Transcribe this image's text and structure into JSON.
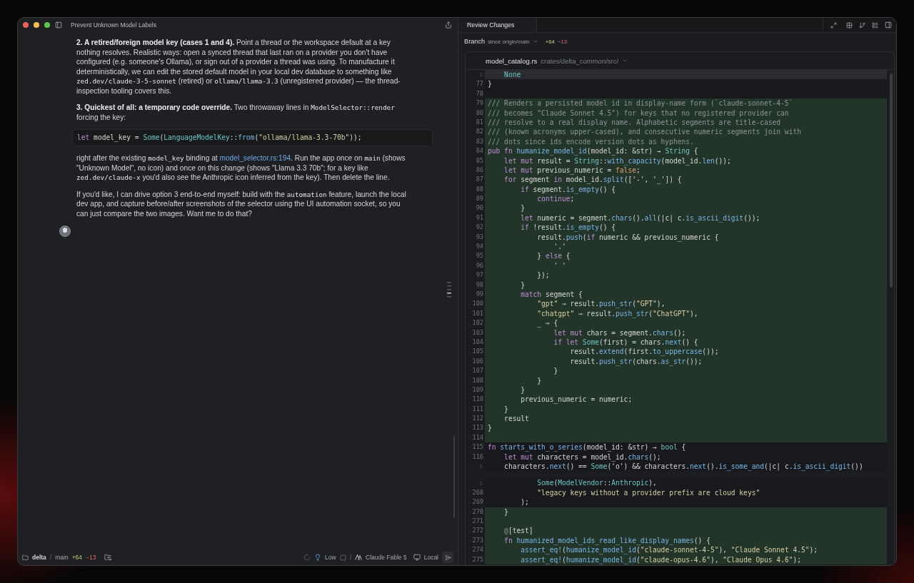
{
  "window": {
    "title": "Prevent Unknown Model Labels"
  },
  "conversation": {
    "blocks": [
      {
        "kind": "paragraph",
        "segments": [
          {
            "kind": "bold",
            "text": "2. A retired/foreign model key (cases 1 and 4)."
          },
          {
            "kind": "text",
            "text": " Point a thread or the workspace default at a key nothing resolves. Realistic ways: open a synced thread that last ran on a provider you don't have configured (e.g. someone's Ollama), or sign out of a provider a thread was using. To manufacture it deterministically, we can edit the stored default model in your local dev database to something like "
          },
          {
            "kind": "code",
            "text": "zed.dev/claude-3-5-sonnet"
          },
          {
            "kind": "text",
            "text": " (retired) or "
          },
          {
            "kind": "code",
            "text": "ollama/llama-3.3"
          },
          {
            "kind": "text",
            "text": " (unregistered provider) — the thread-inspection tooling covers this."
          }
        ]
      },
      {
        "kind": "paragraph",
        "segments": [
          {
            "kind": "bold",
            "text": "3. Quickest of all: a temporary code override."
          },
          {
            "kind": "text",
            "text": " Two throwaway lines in "
          },
          {
            "kind": "code",
            "text": "ModelSelector::render"
          },
          {
            "kind": "text",
            "text": " forcing the key:"
          }
        ]
      },
      {
        "kind": "code",
        "tokens": [
          {
            "kind": "kw",
            "text": "let "
          },
          {
            "kind": "p",
            "text": "model_key = "
          },
          {
            "kind": "ty",
            "text": "Some"
          },
          {
            "kind": "p",
            "text": "("
          },
          {
            "kind": "ty",
            "text": "LanguageModelKey"
          },
          {
            "kind": "p",
            "text": "::"
          },
          {
            "kind": "fn",
            "text": "from"
          },
          {
            "kind": "p",
            "text": "("
          },
          {
            "kind": "str",
            "text": "\"ollama/llama-3.3-70b\""
          },
          {
            "kind": "p",
            "text": "));"
          }
        ]
      },
      {
        "kind": "paragraph",
        "segments": [
          {
            "kind": "text",
            "text": "right after the existing "
          },
          {
            "kind": "code",
            "text": "model_key"
          },
          {
            "kind": "text",
            "text": " binding at "
          },
          {
            "kind": "link",
            "text": "model_selector.rs:194"
          },
          {
            "kind": "text",
            "text": ". Run the app once on "
          },
          {
            "kind": "code",
            "text": "main"
          },
          {
            "kind": "text",
            "text": " (shows \"Unknown Model\", no icon) and once on this change (shows \"Llama 3.3 70b\"; for a key like "
          },
          {
            "kind": "code",
            "text": "zed.dev/claude-x"
          },
          {
            "kind": "text",
            "text": " you'd also see the Anthropic icon inferred from the key). Then delete the line."
          }
        ]
      },
      {
        "kind": "paragraph",
        "segments": [
          {
            "kind": "text",
            "text": "If you'd like, I can drive option 3 end-to-end myself: build with the "
          },
          {
            "kind": "code",
            "text": "automation"
          },
          {
            "kind": "text",
            "text": " feature, launch the local dev app, and capture before/after screenshots of the selector using the UI automation socket, so you can just compare the two images. Want me to do that?"
          }
        ]
      }
    ]
  },
  "status_bar": {
    "project": "delta",
    "separator": "/",
    "branch": "main",
    "added": "+64",
    "removed": "−13",
    "effort": "Low",
    "model_separator": "/",
    "model": "Claude Fable 5",
    "location": "Local"
  },
  "review_panel": {
    "tab": "Review Changes",
    "branch_label": "Branch",
    "branch_scope": "since origin/main",
    "added": "+64",
    "removed": "−13",
    "file": {
      "name": "model_catalog.rs",
      "path": "crates/delta_common/src/"
    },
    "hunks": [
      {
        "lines": [
          {
            "kind": "highlight",
            "expander": true,
            "tokens": [
              {
                "kind": "ty",
                "text": "    None"
              }
            ]
          },
          {
            "kind": "context",
            "number": "77",
            "tokens": [
              {
                "kind": "p",
                "text": "}"
              }
            ]
          },
          {
            "kind": "context",
            "number": "78"
          },
          {
            "kind": "added",
            "number": "79",
            "tokens": [
              {
                "kind": "cm",
                "text": "/// Renders a persisted model id in display-name form (`claude-sonnet-4-5`"
              }
            ]
          },
          {
            "kind": "added",
            "number": "80",
            "tokens": [
              {
                "kind": "cm",
                "text": "/// becomes \"Claude Sonnet 4.5\") for keys that no registered provider can"
              }
            ]
          },
          {
            "kind": "added",
            "number": "81",
            "tokens": [
              {
                "kind": "cm",
                "text": "/// resolve to a real display name. Alphabetic segments are title-cased"
              }
            ]
          },
          {
            "kind": "added",
            "number": "82",
            "tokens": [
              {
                "kind": "cm",
                "text": "/// (known acronyms upper-cased), and consecutive numeric segments join with"
              }
            ]
          },
          {
            "kind": "added",
            "number": "83",
            "tokens": [
              {
                "kind": "cm",
                "text": "/// dots since ids encode version dots as hyphens."
              }
            ]
          },
          {
            "kind": "added",
            "number": "84",
            "tokens": [
              {
                "kind": "kw",
                "text": "pub fn "
              },
              {
                "kind": "fn",
                "text": "humanize_model_id"
              },
              {
                "kind": "p",
                "text": "(model_id: &str) → "
              },
              {
                "kind": "ty",
                "text": "String"
              },
              {
                "kind": "p",
                "text": " {"
              }
            ]
          },
          {
            "kind": "added",
            "number": "85",
            "tokens": [
              {
                "kind": "kw",
                "text": "    let mut "
              },
              {
                "kind": "p",
                "text": "result = "
              },
              {
                "kind": "ty",
                "text": "String"
              },
              {
                "kind": "p",
                "text": "::"
              },
              {
                "kind": "fn",
                "text": "with_capacity"
              },
              {
                "kind": "p",
                "text": "(model_id."
              },
              {
                "kind": "fn",
                "text": "len"
              },
              {
                "kind": "p",
                "text": "());"
              }
            ]
          },
          {
            "kind": "added",
            "number": "86",
            "tokens": [
              {
                "kind": "kw",
                "text": "    let mut "
              },
              {
                "kind": "p",
                "text": "previous_numeric = "
              },
              {
                "kind": "num",
                "text": "false"
              },
              {
                "kind": "p",
                "text": ";"
              }
            ]
          },
          {
            "kind": "added",
            "number": "87",
            "tokens": [
              {
                "kind": "kw",
                "text": "    for "
              },
              {
                "kind": "p",
                "text": "segment "
              },
              {
                "kind": "kw",
                "text": "in "
              },
              {
                "kind": "p",
                "text": "model_id."
              },
              {
                "kind": "fn",
                "text": "split"
              },
              {
                "kind": "p",
                "text": "(['-', '_']) {"
              }
            ]
          },
          {
            "kind": "added",
            "number": "88",
            "tokens": [
              {
                "kind": "kw",
                "text": "        if "
              },
              {
                "kind": "p",
                "text": "segment."
              },
              {
                "kind": "fn",
                "text": "is_empty"
              },
              {
                "kind": "p",
                "text": "() {"
              }
            ]
          },
          {
            "kind": "added",
            "number": "89",
            "tokens": [
              {
                "kind": "kw",
                "text": "            continue"
              },
              {
                "kind": "p",
                "text": ";"
              }
            ]
          },
          {
            "kind": "added",
            "number": "90",
            "tokens": [
              {
                "kind": "p",
                "text": "        }"
              }
            ]
          },
          {
            "kind": "added",
            "number": "91",
            "tokens": [
              {
                "kind": "kw",
                "text": "        let "
              },
              {
                "kind": "p",
                "text": "numeric = segment."
              },
              {
                "kind": "fn",
                "text": "chars"
              },
              {
                "kind": "p",
                "text": "()."
              },
              {
                "kind": "fn",
                "text": "all"
              },
              {
                "kind": "p",
                "text": "(|c| c."
              },
              {
                "kind": "fn",
                "text": "is_ascii_digit"
              },
              {
                "kind": "p",
                "text": "());"
              }
            ]
          },
          {
            "kind": "added",
            "number": "92",
            "tokens": [
              {
                "kind": "kw",
                "text": "        if "
              },
              {
                "kind": "p",
                "text": "!result."
              },
              {
                "kind": "fn",
                "text": "is_empty"
              },
              {
                "kind": "p",
                "text": "() {"
              }
            ]
          },
          {
            "kind": "added",
            "number": "93",
            "tokens": [
              {
                "kind": "p",
                "text": "            result."
              },
              {
                "kind": "fn",
                "text": "push"
              },
              {
                "kind": "p",
                "text": "("
              },
              {
                "kind": "kw",
                "text": "if "
              },
              {
                "kind": "p",
                "text": "numeric && previous_numeric {"
              }
            ]
          },
          {
            "kind": "added",
            "number": "94",
            "tokens": [
              {
                "kind": "str",
                "text": "                '.'"
              }
            ]
          },
          {
            "kind": "added",
            "number": "95",
            "tokens": [
              {
                "kind": "p",
                "text": "            } "
              },
              {
                "kind": "kw",
                "text": "else"
              },
              {
                "kind": "p",
                "text": " {"
              }
            ]
          },
          {
            "kind": "added",
            "number": "96",
            "tokens": [
              {
                "kind": "str",
                "text": "                ' '"
              }
            ]
          },
          {
            "kind": "added",
            "number": "97",
            "tokens": [
              {
                "kind": "p",
                "text": "            });"
              }
            ]
          },
          {
            "kind": "added",
            "number": "98",
            "tokens": [
              {
                "kind": "p",
                "text": "        }"
              }
            ]
          },
          {
            "kind": "added",
            "number": "99",
            "tokens": [
              {
                "kind": "kw",
                "text": "        match "
              },
              {
                "kind": "p",
                "text": "segment {"
              }
            ]
          },
          {
            "kind": "added",
            "number": "100",
            "tokens": [
              {
                "kind": "str",
                "text": "            \"gpt\""
              },
              {
                "kind": "p",
                "text": " ⇒ result."
              },
              {
                "kind": "fn",
                "text": "push_str"
              },
              {
                "kind": "p",
                "text": "("
              },
              {
                "kind": "str",
                "text": "\"GPT\""
              },
              {
                "kind": "p",
                "text": "),"
              }
            ]
          },
          {
            "kind": "added",
            "number": "101",
            "tokens": [
              {
                "kind": "str",
                "text": "            \"chatgpt\""
              },
              {
                "kind": "p",
                "text": " ⇒ result."
              },
              {
                "kind": "fn",
                "text": "push_str"
              },
              {
                "kind": "p",
                "text": "("
              },
              {
                "kind": "str",
                "text": "\"ChatGPT\""
              },
              {
                "kind": "p",
                "text": "),"
              }
            ]
          },
          {
            "kind": "added",
            "number": "102",
            "tokens": [
              {
                "kind": "p",
                "text": "            _ ⇒ {"
              }
            ]
          },
          {
            "kind": "added",
            "number": "103",
            "tokens": [
              {
                "kind": "kw",
                "text": "                let mut "
              },
              {
                "kind": "p",
                "text": "chars = segment."
              },
              {
                "kind": "fn",
                "text": "chars"
              },
              {
                "kind": "p",
                "text": "();"
              }
            ]
          },
          {
            "kind": "added",
            "number": "104",
            "tokens": [
              {
                "kind": "kw",
                "text": "                if let "
              },
              {
                "kind": "ty",
                "text": "Some"
              },
              {
                "kind": "p",
                "text": "(first) = chars."
              },
              {
                "kind": "fn",
                "text": "next"
              },
              {
                "kind": "p",
                "text": "() {"
              }
            ]
          },
          {
            "kind": "added",
            "number": "105",
            "tokens": [
              {
                "kind": "p",
                "text": "                    result."
              },
              {
                "kind": "fn",
                "text": "extend"
              },
              {
                "kind": "p",
                "text": "(first."
              },
              {
                "kind": "fn",
                "text": "to_uppercase"
              },
              {
                "kind": "p",
                "text": "());"
              }
            ]
          },
          {
            "kind": "added",
            "number": "106",
            "tokens": [
              {
                "kind": "p",
                "text": "                    result."
              },
              {
                "kind": "fn",
                "text": "push_str"
              },
              {
                "kind": "p",
                "text": "(chars."
              },
              {
                "kind": "fn",
                "text": "as_str"
              },
              {
                "kind": "p",
                "text": "());"
              }
            ]
          },
          {
            "kind": "added",
            "number": "107",
            "tokens": [
              {
                "kind": "p",
                "text": "                }"
              }
            ]
          },
          {
            "kind": "added",
            "number": "108",
            "tokens": [
              {
                "kind": "p",
                "text": "            }"
              }
            ]
          },
          {
            "kind": "added",
            "number": "109",
            "tokens": [
              {
                "kind": "p",
                "text": "        }"
              }
            ]
          },
          {
            "kind": "added",
            "number": "110",
            "tokens": [
              {
                "kind": "p",
                "text": "        previous_numeric = numeric;"
              }
            ]
          },
          {
            "kind": "added",
            "number": "111",
            "tokens": [
              {
                "kind": "p",
                "text": "    }"
              }
            ]
          },
          {
            "kind": "added",
            "number": "112",
            "tokens": [
              {
                "kind": "p",
                "text": "    result"
              }
            ]
          },
          {
            "kind": "added",
            "number": "113",
            "tokens": [
              {
                "kind": "p",
                "text": "}"
              }
            ]
          },
          {
            "kind": "added",
            "number": "114"
          },
          {
            "kind": "context",
            "number": "115",
            "tokens": [
              {
                "kind": "kw",
                "text": "fn "
              },
              {
                "kind": "fn",
                "text": "starts_with_o_series"
              },
              {
                "kind": "p",
                "text": "(model_id: &str) → "
              },
              {
                "kind": "ty",
                "text": "bool"
              },
              {
                "kind": "p",
                "text": " {"
              }
            ]
          },
          {
            "kind": "context",
            "number": "116",
            "tokens": [
              {
                "kind": "kw",
                "text": "    let mut "
              },
              {
                "kind": "p",
                "text": "characters = model_id."
              },
              {
                "kind": "fn",
                "text": "chars"
              },
              {
                "kind": "p",
                "text": "();"
              }
            ]
          },
          {
            "kind": "context",
            "expander": true,
            "tokens": [
              {
                "kind": "p",
                "text": "    characters."
              },
              {
                "kind": "fn",
                "text": "next"
              },
              {
                "kind": "p",
                "text": "() == "
              },
              {
                "kind": "ty",
                "text": "Some"
              },
              {
                "kind": "p",
                "text": "('o') && characters."
              },
              {
                "kind": "fn",
                "text": "next"
              },
              {
                "kind": "p",
                "text": "()."
              },
              {
                "kind": "fn",
                "text": "is_some_and"
              },
              {
                "kind": "p",
                "text": "(|c| c."
              },
              {
                "kind": "fn",
                "text": "is_ascii_digit"
              },
              {
                "kind": "p",
                "text": "())"
              }
            ]
          }
        ]
      },
      {
        "lines": [
          {
            "kind": "context",
            "expander": true,
            "tokens": [
              {
                "kind": "ty",
                "text": "            Some"
              },
              {
                "kind": "p",
                "text": "("
              },
              {
                "kind": "ty",
                "text": "ModelVendor"
              },
              {
                "kind": "p",
                "text": "::"
              },
              {
                "kind": "ty",
                "text": "Anthropic"
              },
              {
                "kind": "p",
                "text": "),"
              }
            ]
          },
          {
            "kind": "context",
            "number": "268",
            "tokens": [
              {
                "kind": "str",
                "text": "            \"legacy keys without a provider prefix are cloud keys\""
              }
            ]
          },
          {
            "kind": "context",
            "number": "269",
            "tokens": [
              {
                "kind": "p",
                "text": "        );"
              }
            ]
          },
          {
            "kind": "added",
            "number": "270",
            "tokens": [
              {
                "kind": "p",
                "text": "    }"
              }
            ]
          },
          {
            "kind": "added",
            "number": "271"
          },
          {
            "kind": "added",
            "number": "272",
            "tokens": [
              {
                "kind": "cm",
                "text": "    @"
              },
              {
                "kind": "p",
                "text": "[test]"
              }
            ]
          },
          {
            "kind": "added",
            "number": "273",
            "tokens": [
              {
                "kind": "kw",
                "text": "    fn "
              },
              {
                "kind": "fn",
                "text": "humanized_model_ids_read_like_display_names"
              },
              {
                "kind": "p",
                "text": "() {"
              }
            ]
          },
          {
            "kind": "added",
            "number": "274",
            "tokens": [
              {
                "kind": "fn",
                "text": "        assert_eq!"
              },
              {
                "kind": "p",
                "text": "("
              },
              {
                "kind": "fn",
                "text": "humanize_model_id"
              },
              {
                "kind": "p",
                "text": "("
              },
              {
                "kind": "str",
                "text": "\"claude-sonnet-4-5\""
              },
              {
                "kind": "p",
                "text": "), "
              },
              {
                "kind": "str",
                "text": "\"Claude Sonnet 4.5\""
              },
              {
                "kind": "p",
                "text": ");"
              }
            ]
          },
          {
            "kind": "added",
            "number": "275",
            "tokens": [
              {
                "kind": "fn",
                "text": "        assert_eq!"
              },
              {
                "kind": "p",
                "text": "("
              },
              {
                "kind": "fn",
                "text": "humanize_model_id"
              },
              {
                "kind": "p",
                "text": "("
              },
              {
                "kind": "str",
                "text": "\"claude-opus-4.6\""
              },
              {
                "kind": "p",
                "text": "), "
              },
              {
                "kind": "str",
                "text": "\"Claude Opus 4.6\""
              },
              {
                "kind": "p",
                "text": ");"
              }
            ]
          }
        ]
      }
    ]
  }
}
